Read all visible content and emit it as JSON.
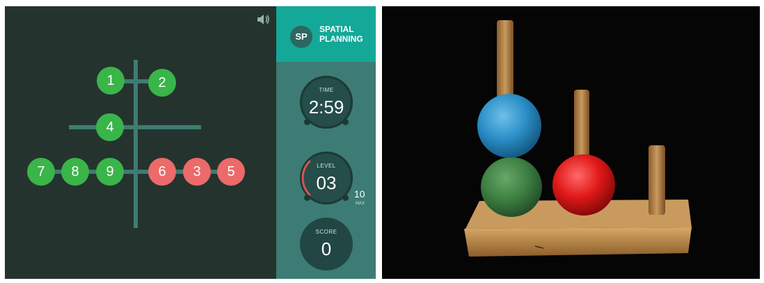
{
  "game": {
    "brand": {
      "badge": "SP",
      "name_line1": "SPATIAL",
      "name_line2": "PLANNING"
    },
    "icons": {
      "sound": "speaker-icon"
    },
    "balls": [
      {
        "label": "1",
        "color": "green"
      },
      {
        "label": "2",
        "color": "green"
      },
      {
        "label": "4",
        "color": "green"
      },
      {
        "label": "7",
        "color": "green"
      },
      {
        "label": "8",
        "color": "green"
      },
      {
        "label": "9",
        "color": "green"
      },
      {
        "label": "6",
        "color": "red"
      },
      {
        "label": "3",
        "color": "red"
      },
      {
        "label": "5",
        "color": "red"
      }
    ],
    "time": {
      "label": "TIME",
      "value": "2:59"
    },
    "level": {
      "label": "LEVEL",
      "value": "03",
      "max": "10",
      "max_label": "MAX",
      "progress": 0.3
    },
    "score": {
      "label": "SCORE",
      "value": "0"
    }
  },
  "colors": {
    "background": "#24332e",
    "rod": "#3f7c72",
    "ball_green": "#3ab54a",
    "ball_red": "#ec6a6a",
    "sidebar": "#3c7c74",
    "brand_bar": "#14a898",
    "level_arc": "#e05050"
  },
  "photo": {
    "subject": "wooden peg board",
    "beads": [
      "blue",
      "green",
      "red"
    ]
  }
}
